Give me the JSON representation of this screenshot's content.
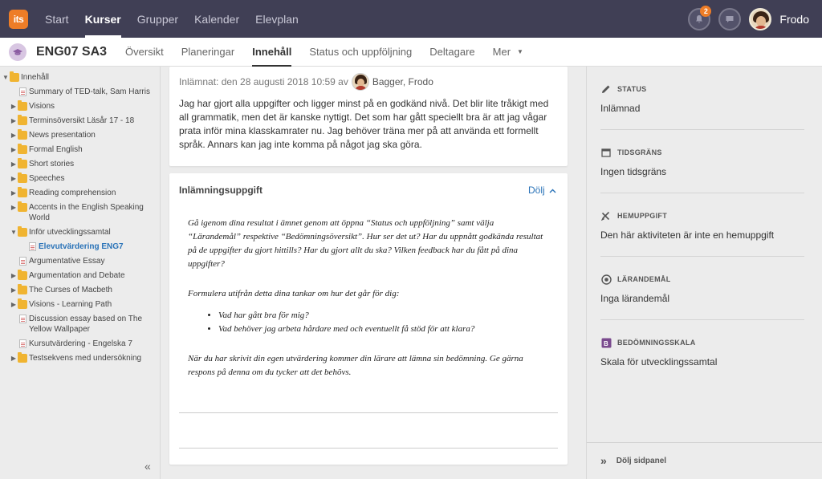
{
  "topbar": {
    "logo_text": "its",
    "nav": [
      "Start",
      "Kurser",
      "Grupper",
      "Kalender",
      "Elevplan"
    ],
    "active_nav": "Kurser",
    "notification_count": "2",
    "user_name": "Frodo",
    "accent_color": "#ee7d27",
    "bg_color": "#403f55"
  },
  "course": {
    "title": "ENG07 SA3",
    "tabs": [
      "Översikt",
      "Planeringar",
      "Innehåll",
      "Status och uppföljning",
      "Deltagare",
      "Mer"
    ],
    "active_tab": "Innehåll"
  },
  "tree": {
    "root": "Innehåll",
    "items": [
      {
        "label": "Summary of TED-talk, Sam Harris",
        "type": "doc"
      },
      {
        "label": "Visions",
        "type": "folder"
      },
      {
        "label": "Terminsöversikt Läsår 17 - 18",
        "type": "folder"
      },
      {
        "label": "News presentation",
        "type": "folder"
      },
      {
        "label": "Formal English",
        "type": "folder"
      },
      {
        "label": "Short stories",
        "type": "folder"
      },
      {
        "label": "Speeches",
        "type": "folder"
      },
      {
        "label": "Reading comprehension",
        "type": "folder"
      },
      {
        "label": "Accents in the English Speaking World",
        "type": "folder"
      },
      {
        "label": "Inför utvecklingssamtal",
        "type": "folder-open"
      },
      {
        "label": "Elevutvärdering ENG7",
        "type": "doc-selected"
      },
      {
        "label": "Argumentative Essay",
        "type": "doc"
      },
      {
        "label": "Argumentation and Debate",
        "type": "folder"
      },
      {
        "label": "The Curses of Macbeth",
        "type": "folder"
      },
      {
        "label": "Visions - Learning Path",
        "type": "folder"
      },
      {
        "label": "Discussion essay based on The Yellow Wallpaper",
        "type": "doc"
      },
      {
        "label": "Kursutvärdering - Engelska 7",
        "type": "doc"
      },
      {
        "label": "Testsekvens med undersökning",
        "type": "folder"
      }
    ]
  },
  "submission": {
    "submitted_prefix": "Inlämnat: den 28 augusti 2018 10:59 av",
    "submitter": "Bagger, Frodo",
    "text": "Jag har gjort alla uppgifter och ligger minst på en godkänd nivå. Det blir lite tråkigt med all grammatik, men det är kanske nyttigt. Det som har gått speciellt bra är att jag vågar prata inför mina klasskamrater nu. Jag behöver träna mer på att använda ett formellt språk. Annars kan jag inte komma på något jag ska göra."
  },
  "task": {
    "header": "Inlämningsuppgift",
    "hide_label": "Dölj",
    "p1": "Gå igenom dina resultat i ämnet genom att öppna “Status och uppföljning” samt välja “Lärandemål” respektive “Bedömningsöversikt”. Hur ser det ut? Har du uppnått godkända resultat på de uppgifter du gjort hittills? Har du gjort allt du ska? Vilken feedback har du fått på dina uppgifter?",
    "p2": "Formulera utifrån detta dina tankar om hur det går för dig:",
    "bullets": [
      "Vad har gått bra för mig?",
      "Vad behöver jag arbeta hårdare med och eventuellt få stöd för att klara?"
    ],
    "p3": "När du har skrivit din egen utvärdering kommer din lärare att lämna sin bedömning. Ge gärna respons på denna om du tycker att det behövs."
  },
  "panel": {
    "items": [
      {
        "title": "STATUS",
        "value": "Inlämnad",
        "icon": "pencil-icon"
      },
      {
        "title": "TIDSGRÄNS",
        "value": "Ingen tidsgräns",
        "icon": "calendar-icon"
      },
      {
        "title": "HEMUPPGIFT",
        "value": "Den här aktiviteten är inte en hemuppgift",
        "icon": "tools-icon"
      },
      {
        "title": "LÄRANDEMÅL",
        "value": "Inga lärandemål",
        "icon": "target-icon"
      },
      {
        "title": "BEDÖMNINGSSKALA",
        "value": "Skala för utvecklingssamtal",
        "icon": "grade-scale-icon"
      }
    ],
    "hide_label": "Dölj sidpanel"
  }
}
